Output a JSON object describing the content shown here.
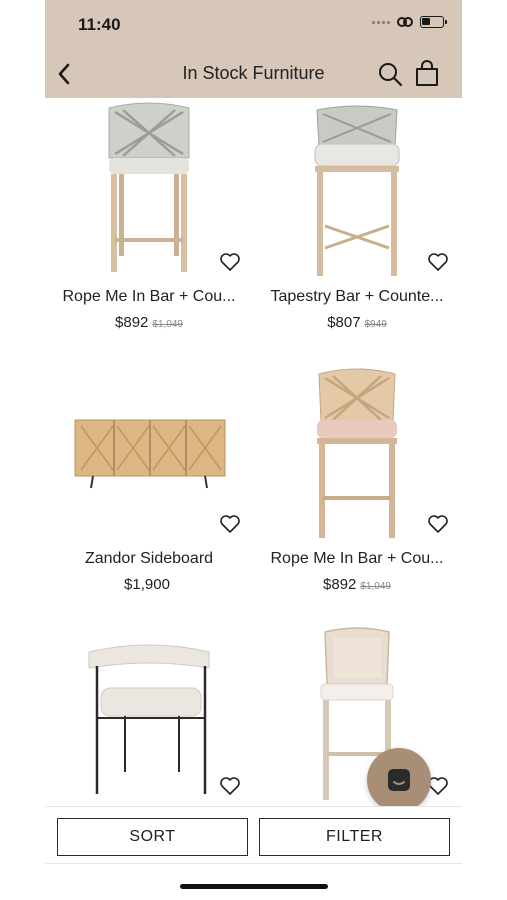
{
  "status": {
    "time": "11:40"
  },
  "header": {
    "title": "In Stock Furniture"
  },
  "products": [
    {
      "name": "Rope Me In Bar + Cou...",
      "price": "$892",
      "old_price": "$1,049"
    },
    {
      "name": "Tapestry Bar + Counte...",
      "price": "$807",
      "old_price": "$949"
    },
    {
      "name": "Zandor Sideboard",
      "price": "$1,900",
      "old_price": ""
    },
    {
      "name": "Rope Me In Bar + Cou...",
      "price": "$892",
      "old_price": "$1,049"
    },
    {
      "name": "",
      "price": "",
      "old_price": ""
    },
    {
      "name": "",
      "price": "",
      "old_price": ""
    }
  ],
  "actions": {
    "sort": "SORT",
    "filter": "FILTER"
  },
  "colors": {
    "header_bg": "#d6c7b8",
    "fab_bg": "#a98e77"
  },
  "icons": [
    "back-chevron-icon",
    "search-icon",
    "shopping-bag-icon",
    "heart-icon",
    "chat-icon"
  ]
}
